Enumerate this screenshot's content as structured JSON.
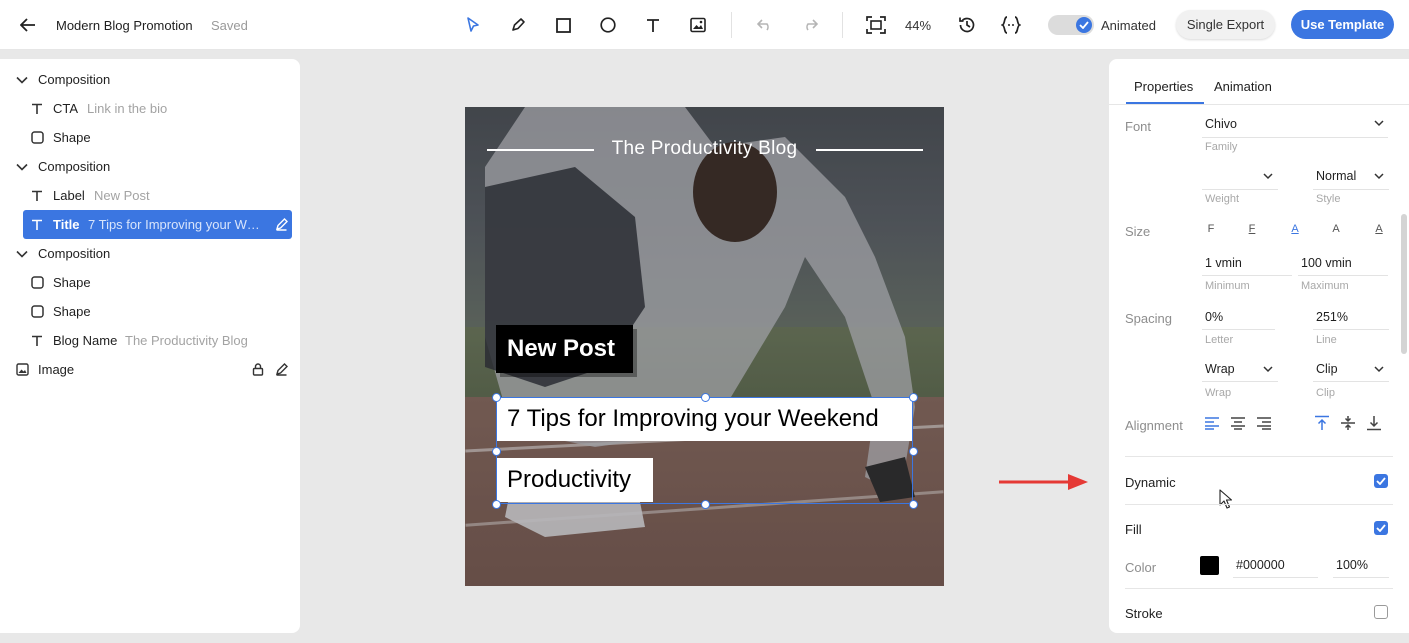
{
  "header": {
    "doc_title": "Modern Blog Promotion",
    "save_status": "Saved",
    "zoom": "44%",
    "animated_label": "Animated",
    "animated_on": true,
    "single_export_label": "Single Export",
    "use_template_label": "Use Template"
  },
  "layers": [
    {
      "type": "composition",
      "name": "Composition"
    },
    {
      "type": "text",
      "name": "CTA",
      "value": "Link in the bio"
    },
    {
      "type": "shape",
      "name": "Shape"
    },
    {
      "type": "composition",
      "name": "Composition"
    },
    {
      "type": "text",
      "name": "Label",
      "value": "New Post"
    },
    {
      "type": "text",
      "name": "Title",
      "value": "7 Tips for Improving your Weekend Productivity",
      "selected": true
    },
    {
      "type": "composition",
      "name": "Composition"
    },
    {
      "type": "shape",
      "name": "Shape"
    },
    {
      "type": "shape",
      "name": "Shape"
    },
    {
      "type": "text",
      "name": "Blog Name",
      "value": "The Productivity Blog"
    },
    {
      "type": "image",
      "name": "Image"
    }
  ],
  "canvas": {
    "blog_name": "The Productivity Blog",
    "label": "New Post",
    "title_line1": "7 Tips for Improving your Weekend",
    "title_line2": "Productivity"
  },
  "properties": {
    "tabs": [
      "Properties",
      "Animation"
    ],
    "active_tab": "Properties",
    "font": {
      "label": "Font",
      "family": "Chivo",
      "family_hint": "Family",
      "weight": "",
      "weight_hint": "Weight",
      "style": "Normal",
      "style_hint": "Style"
    },
    "size": {
      "label": "Size",
      "options": [
        "F",
        "F",
        "A",
        "A",
        "A"
      ],
      "active_index": 2,
      "minimum": "1 vmin",
      "minimum_hint": "Minimum",
      "maximum": "100 vmin",
      "maximum_hint": "Maximum"
    },
    "spacing": {
      "label": "Spacing",
      "letter": "0%",
      "letter_hint": "Letter",
      "line": "251%",
      "line_hint": "Line",
      "wrap": "Wrap",
      "wrap_hint": "Wrap",
      "clip": "Clip",
      "clip_hint": "Clip"
    },
    "alignment": {
      "label": "Alignment",
      "horizontal_active": "left",
      "vertical_active": "top"
    },
    "dynamic": {
      "label": "Dynamic",
      "checked": true
    },
    "fill": {
      "label": "Fill",
      "checked": true
    },
    "color": {
      "label": "Color",
      "hex": "#000000",
      "opacity": "100%"
    },
    "stroke": {
      "label": "Stroke",
      "checked": false
    }
  },
  "colors": {
    "accent": "#3b76e1",
    "arrow": "#e53935"
  }
}
